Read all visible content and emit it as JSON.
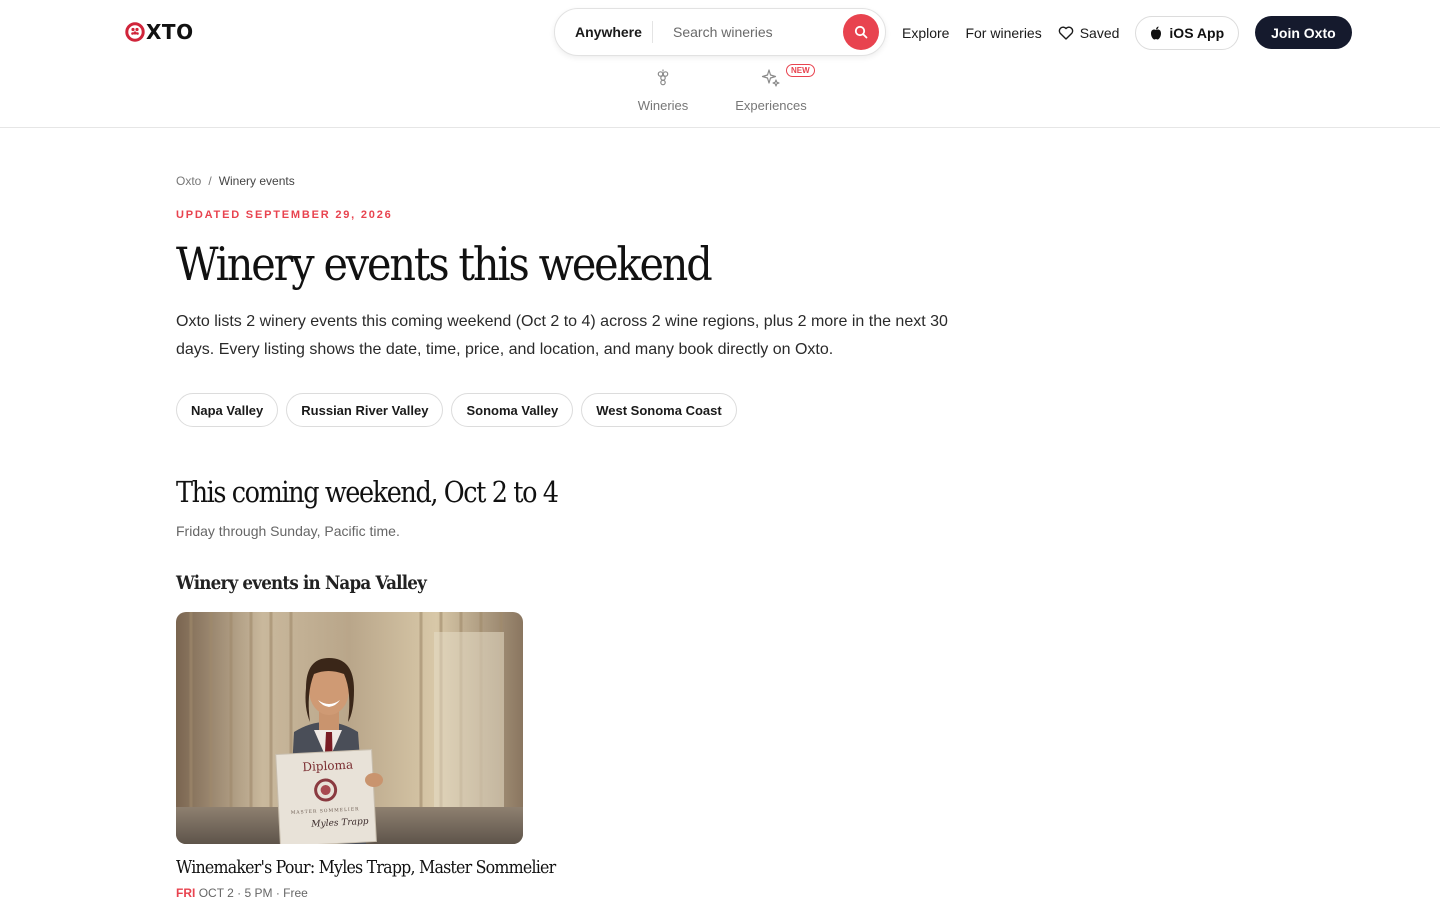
{
  "header": {
    "logo_text": "XTO",
    "search": {
      "where": "Anywhere",
      "placeholder": "Search wineries"
    },
    "nav": {
      "explore": "Explore",
      "for_wineries": "For wineries",
      "saved": "Saved",
      "ios_app": "iOS App",
      "join": "Join Oxto"
    },
    "subnav": {
      "wineries": "Wineries",
      "experiences": "Experiences",
      "new_badge": "NEW"
    }
  },
  "breadcrumb": {
    "root": "Oxto",
    "separator": "/",
    "current": "Winery events"
  },
  "updated": "UPDATED SEPTEMBER 29, 2026",
  "title": "Winery events this weekend",
  "intro": "Oxto lists 2 winery events this coming weekend (Oct 2 to 4) across 2 wine regions, plus 2 more in the next 30 days. Every listing shows the date, time, price, and location, and many book directly on Oxto.",
  "regions": [
    "Napa Valley",
    "Russian River Valley",
    "Sonoma Valley",
    "West Sonoma Coast"
  ],
  "weekend": {
    "title": "This coming weekend, Oct 2 to 4",
    "subtitle": "Friday through Sunday, Pacific time.",
    "region_heading": "Winery events in Napa Valley"
  },
  "event": {
    "title": "Winemaker's Pour: Myles Trapp, Master Sommelier",
    "day": "FRI",
    "details": "OCT 2 · 5 PM · Free",
    "diploma_heading": "Diploma",
    "diploma_line": "MASTER SOMMELIER",
    "diploma_name": "Myles Trapp"
  },
  "colors": {
    "accent": "#e8434f",
    "dark_button": "#151a2d"
  }
}
